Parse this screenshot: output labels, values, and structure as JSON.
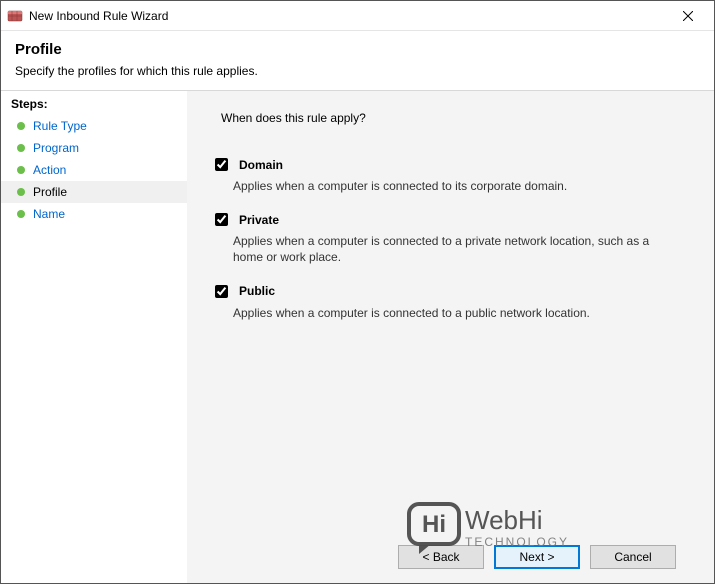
{
  "titlebar": {
    "title": "New Inbound Rule Wizard"
  },
  "header": {
    "title": "Profile",
    "subtitle": "Specify the profiles for which this rule applies."
  },
  "sidebar": {
    "title": "Steps:",
    "items": [
      {
        "label": "Rule Type",
        "active": false
      },
      {
        "label": "Program",
        "active": false
      },
      {
        "label": "Action",
        "active": false
      },
      {
        "label": "Profile",
        "active": true
      },
      {
        "label": "Name",
        "active": false
      }
    ]
  },
  "main": {
    "question": "When does this rule apply?",
    "options": [
      {
        "name": "domain",
        "label": "Domain",
        "checked": true,
        "desc": "Applies when a computer is connected to its corporate domain."
      },
      {
        "name": "private",
        "label": "Private",
        "checked": true,
        "desc": "Applies when a computer is connected to a private network location, such as a home or work place."
      },
      {
        "name": "public",
        "label": "Public",
        "checked": true,
        "desc": "Applies when a computer is connected to a public network location."
      }
    ]
  },
  "footer": {
    "back": "< Back",
    "next": "Next >",
    "cancel": "Cancel"
  },
  "watermark": {
    "line1": "WebHi",
    "line2": "TECHNOLOGY",
    "bubble": "Hi"
  }
}
